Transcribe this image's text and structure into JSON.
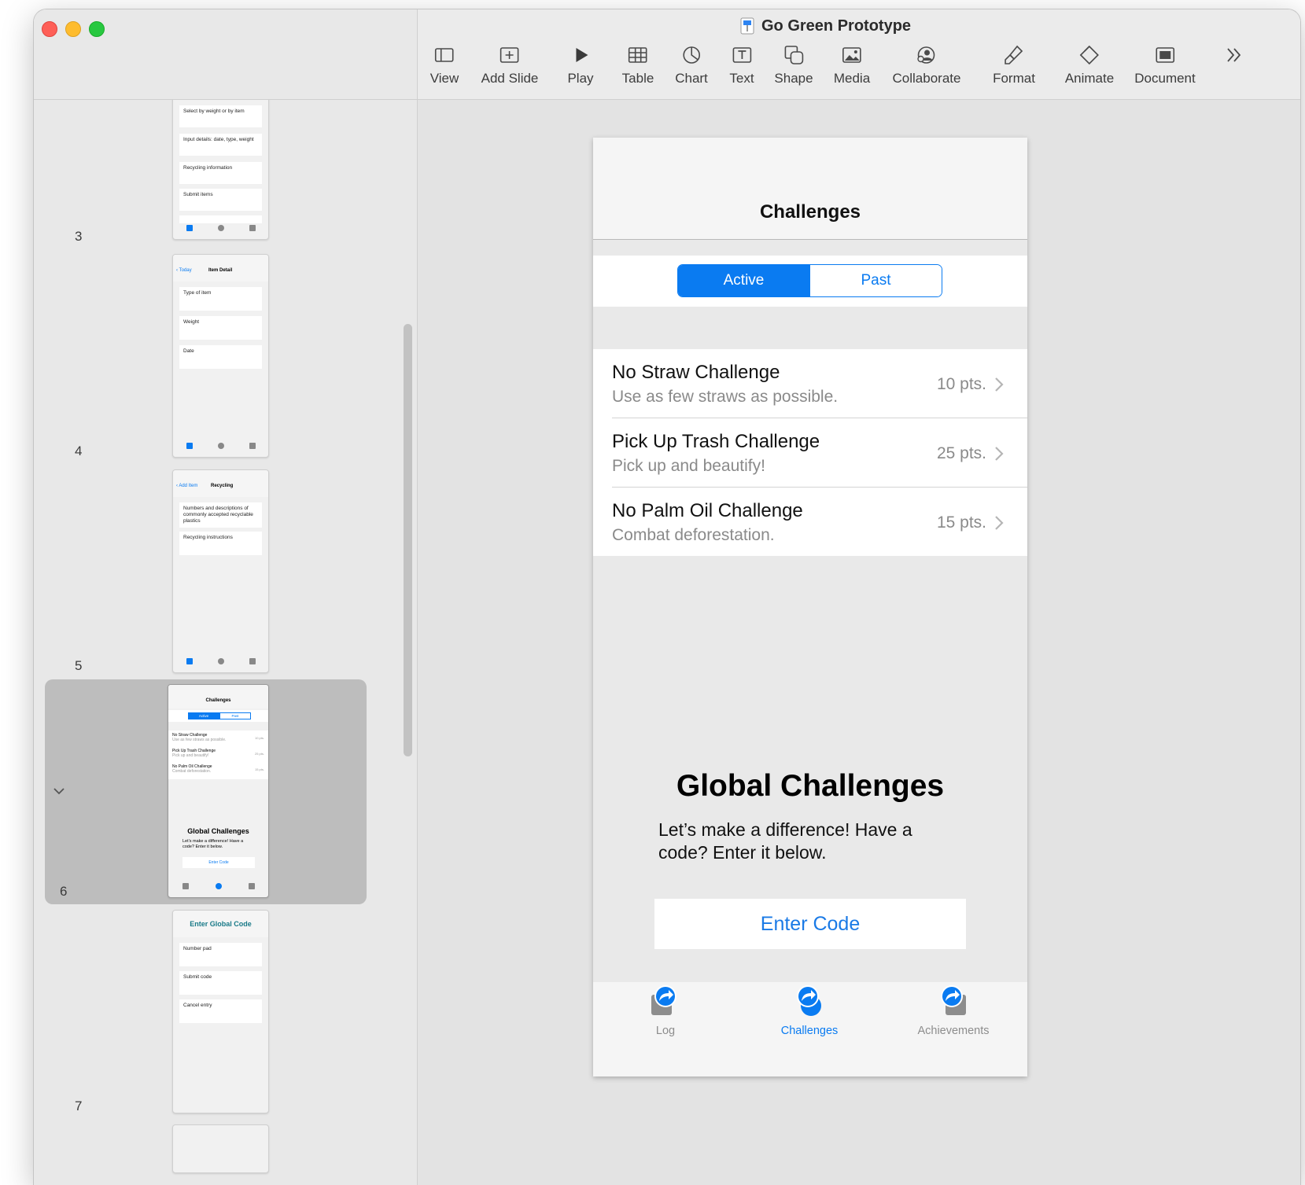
{
  "window": {
    "title": "Go Green Prototype",
    "controls": [
      "close",
      "minimize",
      "zoom"
    ]
  },
  "toolbar": {
    "items": [
      {
        "label": "View",
        "icon": "sidebar-icon"
      },
      {
        "label": "Add Slide",
        "icon": "add-slide-icon"
      },
      {
        "label": "Play",
        "icon": "play-icon"
      },
      {
        "label": "Table",
        "icon": "table-icon"
      },
      {
        "label": "Chart",
        "icon": "chart-icon"
      },
      {
        "label": "Text",
        "icon": "text-icon"
      },
      {
        "label": "Shape",
        "icon": "shape-icon"
      },
      {
        "label": "Media",
        "icon": "media-icon"
      },
      {
        "label": "Collaborate",
        "icon": "collaborate-icon"
      },
      {
        "label": "Format",
        "icon": "format-brush-icon"
      },
      {
        "label": "Animate",
        "icon": "animate-icon"
      },
      {
        "label": "Document",
        "icon": "document-icon"
      }
    ],
    "overflow_icon": "chevron-double-right-icon"
  },
  "navigator": {
    "slides": [
      {
        "number": "3",
        "rows": [
          "Select by weight or by item",
          "Input details: date, type, weight",
          "Recycling information",
          "Submit items"
        ],
        "tabs": [
          "Log",
          "Challenges",
          "Achievements"
        ]
      },
      {
        "number": "4",
        "back": "Today",
        "title": "Item Detail",
        "rows": [
          "Type of item",
          "Weight",
          "Date"
        ],
        "tabs": [
          "Log",
          "Challenges",
          "Achievements"
        ]
      },
      {
        "number": "5",
        "back": "Add Item",
        "title": "Recycling",
        "rows": [
          "Numbers and descriptions of commonly accepted recyclable plastics",
          "Recycling instructions"
        ],
        "tabs": [
          "Log",
          "Challenges",
          "Achievements"
        ]
      },
      {
        "number": "6",
        "title": "Challenges",
        "segments": [
          "Active",
          "Past"
        ],
        "rows": [
          {
            "title": "No Straw Challenge",
            "sub": "Use as few straws as possible.",
            "pts": "10 pts."
          },
          {
            "title": "Pick Up Trash Challenge",
            "sub": "Pick up and beautify!",
            "pts": "25 pts."
          },
          {
            "title": "No Palm Oil Challenge",
            "sub": "Combat deforestation.",
            "pts": "15 pts."
          }
        ],
        "global_title": "Global Challenges",
        "global_text": "Let’s make a difference! Have a code? Enter it below.",
        "button": "Enter Code",
        "tabs": [
          "Log",
          "Challenges",
          "Achievements"
        ]
      },
      {
        "number": "7",
        "title": "Enter Global Code",
        "rows": [
          "Number pad",
          "Submit code",
          "Cancel entry"
        ]
      }
    ]
  },
  "slide": {
    "title": "Challenges",
    "segments": {
      "active": "Active",
      "past": "Past"
    },
    "challenges": [
      {
        "title": "No Straw Challenge",
        "subtitle": "Use as few straws as possible.",
        "points": "10 pts."
      },
      {
        "title": "Pick Up Trash Challenge",
        "subtitle": "Pick up and beautify!",
        "points": "25 pts."
      },
      {
        "title": "No Palm Oil Challenge",
        "subtitle": "Combat deforestation.",
        "points": "15 pts."
      }
    ],
    "global": {
      "title": "Global Challenges",
      "text": "Let’s make a difference! Have a code? Enter it below.",
      "button": "Enter Code"
    },
    "tabs": [
      {
        "label": "Log",
        "active": false
      },
      {
        "label": "Challenges",
        "active": true
      },
      {
        "label": "Achievements",
        "active": false
      }
    ]
  },
  "colors": {
    "accent": "#0a7bf1",
    "close": "#fe5f57",
    "minimize": "#febc2e",
    "zoom": "#28c840",
    "selection": "#bdbdbd"
  }
}
